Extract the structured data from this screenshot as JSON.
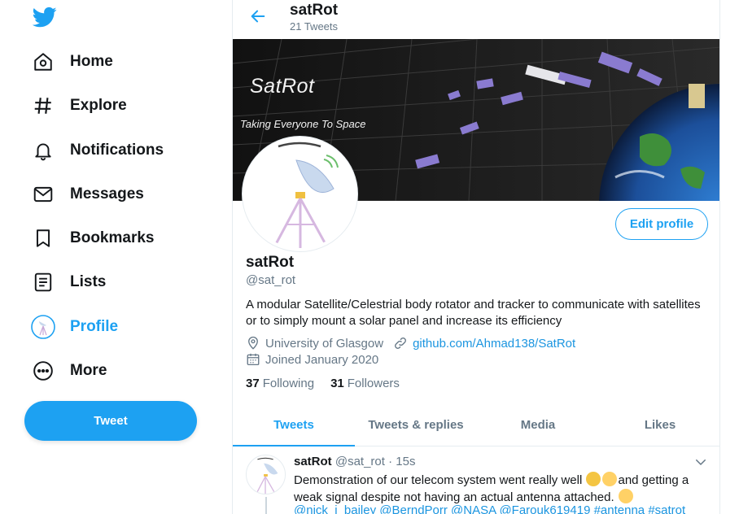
{
  "sidebar": {
    "logo_icon": "twitter-bird-icon",
    "items": [
      {
        "label": "Home",
        "icon": "home-icon"
      },
      {
        "label": "Explore",
        "icon": "hashtag-icon"
      },
      {
        "label": "Notifications",
        "icon": "bell-icon"
      },
      {
        "label": "Messages",
        "icon": "envelope-icon"
      },
      {
        "label": "Bookmarks",
        "icon": "bookmark-icon"
      },
      {
        "label": "Lists",
        "icon": "list-icon"
      },
      {
        "label": "Profile",
        "icon": "avatar-icon",
        "active": true
      },
      {
        "label": "More",
        "icon": "more-circle-icon"
      }
    ],
    "tweet_button": "Tweet"
  },
  "header": {
    "title": "satRot",
    "subtitle": "21 Tweets"
  },
  "banner": {
    "title": "SatRot",
    "tagline": "Taking Everyone To Space"
  },
  "profile": {
    "name": "satRot",
    "handle": "@sat_rot",
    "bio": "A modular Satellite/Celestrial body rotator and tracker to communicate with satellites or to simply mount a solar panel and increase its efficiency",
    "location": "University of Glasgow",
    "website": "github.com/Ahmad138/SatRot",
    "joined": "Joined January 2020",
    "following_count": "37",
    "following_label": "Following",
    "followers_count": "31",
    "followers_label": "Followers",
    "edit_button": "Edit profile"
  },
  "tabs": [
    {
      "label": "Tweets",
      "active": true
    },
    {
      "label": "Tweets & replies"
    },
    {
      "label": "Media"
    },
    {
      "label": "Likes"
    }
  ],
  "tweet": {
    "name": "satRot",
    "handle": "@sat_rot",
    "separator": "·",
    "time": "15s",
    "text_part1": "Demonstration of our telecom system went really well",
    "text_part2": "and getting a weak signal despite not having an actual antenna attached.",
    "mentions": "@nick_j_bailey @BerndPorr @NASA @Farouk619419 #antenna #satrot"
  },
  "colors": {
    "accent": "#1da1f2",
    "text": "#14171a",
    "muted": "#657786",
    "border": "#e6ecf0"
  }
}
